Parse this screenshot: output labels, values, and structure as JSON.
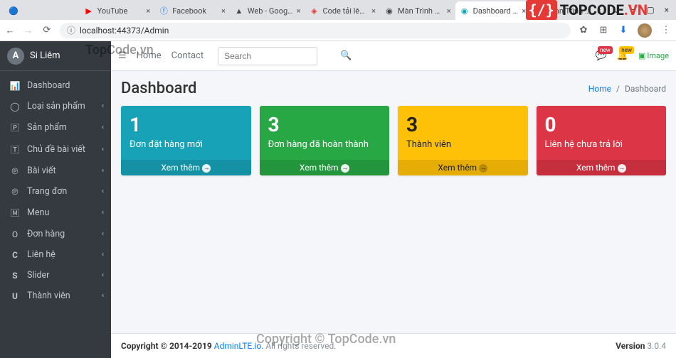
{
  "browser": {
    "tabs": [
      {
        "title": "",
        "favicon": "chrome-dot"
      },
      {
        "title": "YouTube",
        "favicon": "youtube"
      },
      {
        "title": "Facebook",
        "favicon": "facebook"
      },
      {
        "title": "Web - Google Drive",
        "favicon": "gdrive"
      },
      {
        "title": "Code tải lên của tôi",
        "favicon": "topcode"
      },
      {
        "title": "Màn Trình Diễn Đầy",
        "favicon": "generic"
      },
      {
        "title": "Dashboard - Quản lý",
        "favicon": "admin",
        "active": true
      },
      {
        "title": "Màn Trình Diễn Đầy",
        "favicon": "generic"
      }
    ],
    "url": "localhost:44373/Admin"
  },
  "brand_overlay": {
    "prefix": "{/}",
    "name_a": "TOPCODE",
    "name_b": ".VN"
  },
  "watermarks": {
    "top": "TopCode.vn",
    "bottom": "Copyright © TopCode.vn"
  },
  "sidebar": {
    "brand": "Si Liêm",
    "items": [
      {
        "icon": "tachometer",
        "label": "Dashboard",
        "active": true,
        "expandable": false
      },
      {
        "icon": "circle",
        "label": "Loại sản phẩm",
        "expandable": true
      },
      {
        "icon": "p-square",
        "label": "Sản phẩm",
        "expandable": true
      },
      {
        "icon": "t-square",
        "label": "Chủ đề bài viết",
        "expandable": true
      },
      {
        "icon": "pinterest",
        "label": "Bài viết",
        "expandable": true
      },
      {
        "icon": "pinterest",
        "label": "Trang đơn",
        "expandable": true
      },
      {
        "icon": "m-square",
        "label": "Menu",
        "expandable": true
      },
      {
        "icon": "o-circle",
        "label": "Đơn hàng",
        "expandable": true
      },
      {
        "icon": "c-bold",
        "label": "Liên hệ",
        "expandable": true
      },
      {
        "icon": "s-bold",
        "label": "Slider",
        "expandable": true
      },
      {
        "icon": "u-bold",
        "label": "Thành viên",
        "expandable": true
      }
    ]
  },
  "topnav": {
    "home": "Home",
    "contact": "Contact",
    "search_placeholder": "Search",
    "notif_badge": "new",
    "bell_badge": "new",
    "image_label": "Image"
  },
  "header": {
    "title": "Dashboard",
    "breadcrumb_home": "Home",
    "breadcrumb_sep": "/",
    "breadcrumb_current": "Dashboard"
  },
  "cards": [
    {
      "value": "1",
      "label": "Đơn đặt hàng mới",
      "more": "Xem thêm",
      "color": "info"
    },
    {
      "value": "3",
      "label": "Đơn hàng đã hoàn thành",
      "more": "Xem thêm",
      "color": "success"
    },
    {
      "value": "3",
      "label": "Thành viên",
      "more": "Xem thêm",
      "color": "warning"
    },
    {
      "value": "0",
      "label": "Liên hệ chưa trả lời",
      "more": "Xem thêm",
      "color": "danger"
    }
  ],
  "footer": {
    "copyright_prefix": "Copyright © 2014-2019 ",
    "brand": "AdminLTE.io.",
    "suffix": " All rights reserved.",
    "version_label": "Version",
    "version": " 3.0.4"
  }
}
